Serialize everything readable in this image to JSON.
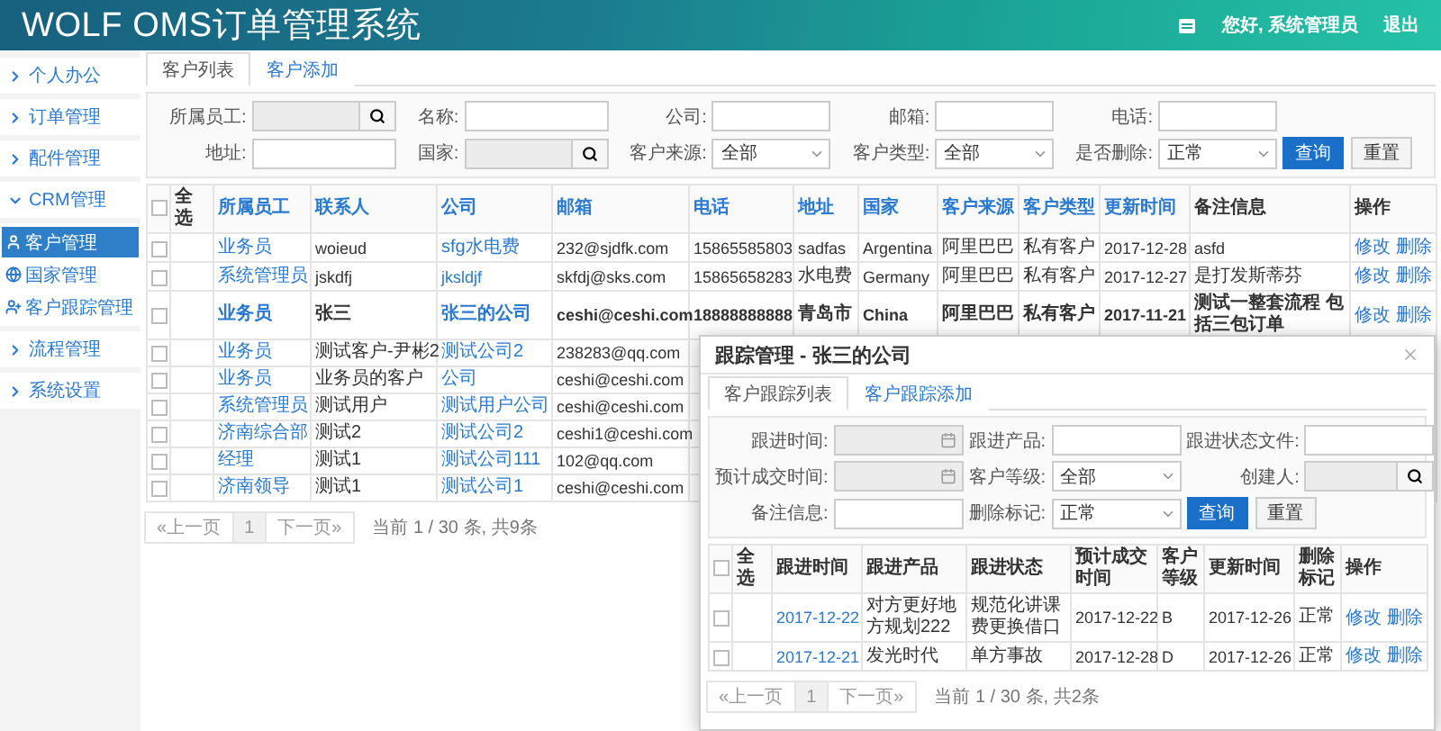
{
  "header": {
    "title": "WOLF OMS订单管理系统",
    "greeting": "您好, 系统管理员",
    "logout": "退出"
  },
  "sidebar": {
    "items": [
      {
        "label": "个人办公",
        "expanded": false
      },
      {
        "label": "订单管理",
        "expanded": false
      },
      {
        "label": "配件管理",
        "expanded": false
      },
      {
        "label": "CRM管理",
        "expanded": true,
        "children": [
          {
            "label": "客户管理",
            "selected": true
          },
          {
            "label": "国家管理",
            "selected": false
          },
          {
            "label": "客户跟踪管理",
            "selected": false
          }
        ]
      },
      {
        "label": "流程管理",
        "expanded": false
      },
      {
        "label": "系统设置",
        "expanded": false
      }
    ]
  },
  "main": {
    "tabs": [
      {
        "label": "客户列表",
        "selected": true
      },
      {
        "label": "客户添加",
        "selected": false
      }
    ],
    "filters": [
      [
        {
          "label": "所属员工:",
          "kind": "lookup",
          "disabled": true
        },
        {
          "label": "名称:",
          "kind": "text"
        },
        {
          "label": "公司:",
          "kind": "text"
        },
        {
          "label": "邮箱:",
          "kind": "text"
        },
        {
          "label": "电话:",
          "kind": "text"
        }
      ],
      [
        {
          "label": "地址:",
          "kind": "text"
        },
        {
          "label": "国家:",
          "kind": "lookup",
          "disabled": true
        },
        {
          "label": "客户来源:",
          "kind": "select",
          "value": "全部"
        },
        {
          "label": "客户类型:",
          "kind": "select",
          "value": "全部"
        },
        {
          "label": "是否删除:",
          "kind": "select",
          "value": "正常"
        }
      ]
    ],
    "buttons": [
      {
        "label": "查询",
        "kind": "primary"
      },
      {
        "label": "重置",
        "kind": "default"
      }
    ],
    "table": {
      "select_all": {
        "label": "全选",
        "checked": false
      },
      "columns": [
        {
          "label": "所属员工",
          "kind": "link",
          "sortable": true
        },
        {
          "label": "联系人",
          "kind": "text",
          "sortable": true
        },
        {
          "label": "公司",
          "kind": "link",
          "sortable": true
        },
        {
          "label": "邮箱",
          "kind": "text",
          "sortable": true
        },
        {
          "label": "电话",
          "kind": "text",
          "sortable": true
        },
        {
          "label": "地址",
          "kind": "text",
          "sortable": true
        },
        {
          "label": "国家",
          "kind": "text",
          "sortable": true
        },
        {
          "label": "客户来源",
          "kind": "text",
          "sortable": true
        },
        {
          "label": "客户类型",
          "kind": "text",
          "sortable": true
        },
        {
          "label": "更新时间",
          "kind": "text",
          "sortable": true
        },
        {
          "label": "备注信息",
          "kind": "text",
          "sortable": false
        },
        {
          "label": "操作",
          "kind": "actions",
          "sortable": false
        }
      ],
      "rows": [
        {
          "checked": false,
          "highlighted": false,
          "cells": [
            "业务员",
            "woieud",
            "sfg水电费",
            "232@sjdfk.com",
            "15865585803",
            "sadfas",
            "Argentina",
            "阿里巴巴",
            "私有客户",
            "2017-12-28",
            "asfd"
          ],
          "actions": [
            "修改",
            "删除"
          ]
        },
        {
          "checked": false,
          "highlighted": false,
          "cells": [
            "系统管理员",
            "jskdfj",
            "jksldjf",
            "skfdj@sks.com",
            "15865658283",
            "水电费",
            "Germany",
            "阿里巴巴",
            "私有客户",
            "2017-12-27",
            "是打发斯蒂芬"
          ],
          "actions": [
            "修改",
            "删除"
          ]
        },
        {
          "checked": false,
          "highlighted": true,
          "cells": [
            "业务员",
            "张三",
            "张三的公司",
            "ceshi@ceshi.com",
            "18888888888",
            "青岛市",
            "China",
            "阿里巴巴",
            "私有客户",
            "2017-11-21",
            "测试一整套流程 包括三包订单"
          ],
          "actions": [
            "修改",
            "删除"
          ]
        },
        {
          "checked": false,
          "highlighted": false,
          "cells": [
            "业务员",
            "测试客户-尹彬2",
            "测试公司2",
            "238283@qq.com"
          ]
        },
        {
          "checked": false,
          "highlighted": false,
          "cells": [
            "业务员",
            "业务员的客户",
            "公司",
            "ceshi@ceshi.com"
          ]
        },
        {
          "checked": false,
          "highlighted": false,
          "cells": [
            "系统管理员",
            "测试用户",
            "测试用户公司",
            "ceshi@ceshi.com"
          ]
        },
        {
          "checked": false,
          "highlighted": false,
          "cells": [
            "济南综合部",
            "测试2",
            "测试公司2",
            "ceshi1@ceshi.com"
          ]
        },
        {
          "checked": false,
          "highlighted": false,
          "cells": [
            "经理",
            "测试1",
            "测试公司111",
            "102@qq.com"
          ]
        },
        {
          "checked": false,
          "highlighted": false,
          "cells": [
            "济南领导",
            "测试1",
            "测试公司1",
            "ceshi@ceshi.com"
          ]
        }
      ]
    },
    "pagination": {
      "prev": "«上一页",
      "page": "1",
      "next": "下一页»",
      "summary": "当前 1 / 30 条, 共9条"
    }
  },
  "modal": {
    "title": "跟踪管理 - 张三的公司",
    "tabs": [
      {
        "label": "客户跟踪列表",
        "selected": true
      },
      {
        "label": "客户跟踪添加",
        "selected": false
      }
    ],
    "filters": [
      [
        {
          "label": "跟进时间:",
          "kind": "date",
          "disabled": true
        },
        {
          "label": "跟进产品:",
          "kind": "text"
        },
        {
          "label": "跟进状态文件:",
          "kind": "text"
        }
      ],
      [
        {
          "label": "预计成交时间:",
          "kind": "date",
          "disabled": true
        },
        {
          "label": "客户等级:",
          "kind": "select",
          "value": "全部"
        },
        {
          "label": "创建人:",
          "kind": "lookup",
          "disabled": true
        }
      ],
      [
        {
          "label": "备注信息:",
          "kind": "text"
        },
        {
          "label": "删除标记:",
          "kind": "select",
          "value": "正常"
        }
      ]
    ],
    "buttons": [
      {
        "label": "查询",
        "kind": "primary"
      },
      {
        "label": "重置",
        "kind": "default"
      }
    ],
    "table": {
      "select_all": {
        "label": "全选",
        "checked": false
      },
      "columns": [
        {
          "label": "跟进时间",
          "kind": "link",
          "sortable": false
        },
        {
          "label": "跟进产品",
          "kind": "text",
          "sortable": false
        },
        {
          "label": "跟进状态",
          "kind": "text",
          "sortable": false
        },
        {
          "label": "预计成交时间",
          "kind": "text",
          "sortable": false
        },
        {
          "label": "客户等级",
          "kind": "text",
          "sortable": false
        },
        {
          "label": "更新时间",
          "kind": "text",
          "sortable": false
        },
        {
          "label": "删除标记",
          "kind": "text",
          "sortable": false
        },
        {
          "label": "操作",
          "kind": "actions",
          "sortable": false
        }
      ],
      "rows": [
        {
          "checked": false,
          "highlighted": false,
          "cells": [
            "2017-12-22",
            "对方更好地方规划222",
            "规范化讲课费更换借口",
            "2017-12-22",
            "B",
            "2017-12-26",
            "正常"
          ],
          "actions": [
            "修改",
            "删除"
          ]
        },
        {
          "checked": false,
          "highlighted": false,
          "cells": [
            "2017-12-21",
            "发光时代",
            "单方事故",
            "2017-12-28",
            "D",
            "2017-12-26",
            "正常"
          ],
          "actions": [
            "修改",
            "删除"
          ]
        }
      ]
    },
    "pagination": {
      "prev": "«上一页",
      "page": "1",
      "next": "下一页»",
      "summary": "当前 1 / 30 条, 共2条"
    }
  }
}
